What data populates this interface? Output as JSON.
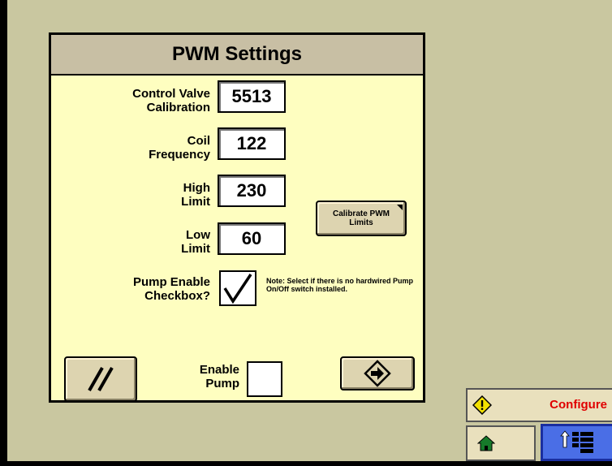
{
  "panel": {
    "title": "PWM Settings",
    "fields": [
      {
        "label_line1": "Control Valve",
        "label_line2": "Calibration",
        "value": "5513"
      },
      {
        "label_line1": "Coil",
        "label_line2": "Frequency",
        "value": "122"
      },
      {
        "label_line1": "High",
        "label_line2": "Limit",
        "value": "230"
      },
      {
        "label_line1": "Low",
        "label_line2": "Limit",
        "value": "60"
      }
    ],
    "calibrate_button": {
      "line1": "Calibrate PWM",
      "line2": "Limits"
    },
    "pump_enable": {
      "label_line1": "Pump Enable",
      "label_line2": "Checkbox?",
      "checked": true
    },
    "note": "Note: Select if there is no hardwired Pump On/Off switch installed.",
    "enable_pump": {
      "label_line1": "Enable",
      "label_line2": "Pump",
      "checked": false
    }
  },
  "nav": {
    "configure_label": "Configure"
  },
  "colors": {
    "background": "#c9c7a0",
    "panel": "#fefec0",
    "title_bar": "#c8bfa4",
    "button": "#ddd4b0",
    "configure_text": "#e00000",
    "menu_button": "#4a6ee6"
  },
  "icons": {
    "reset": "double-slash-icon",
    "next": "arrow-right-diamond-icon",
    "warning": "warning-diamond-icon",
    "home": "home-icon",
    "menu": "up-arrow-menu-icon"
  }
}
